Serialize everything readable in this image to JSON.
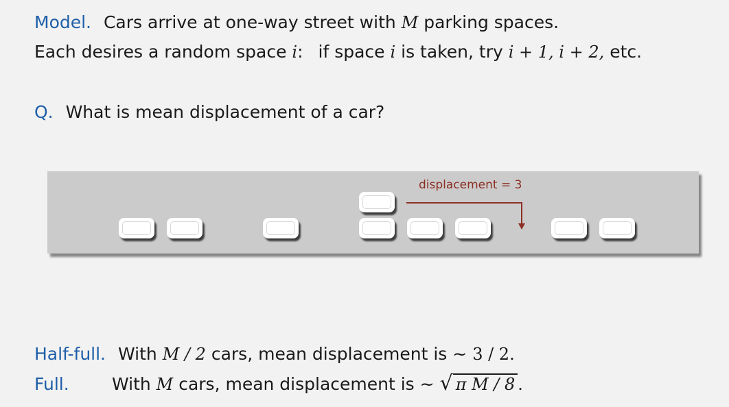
{
  "model": {
    "keyword": "Model.",
    "line1_a": "Cars arrive at one-way street with",
    "line1_var": "M",
    "line1_b": "parking spaces.",
    "line2_a": "Each desires a random space",
    "line2_var": "i",
    "line2_colon": ":",
    "line2_b": "if space",
    "line2_var2": "i",
    "line2_c": "is taken, try",
    "line2_math": "i + 1, i + 2,",
    "line2_d": "etc."
  },
  "question": {
    "keyword": "Q.",
    "text": "What is mean displacement of a car?"
  },
  "diagram": {
    "displacement_label": "displacement = 3",
    "colors": {
      "arrow": "#8c2f24",
      "street": "#cbcbcb",
      "car": "#ffffff"
    }
  },
  "half_full": {
    "keyword": "Half-full.",
    "text_a": "With",
    "math_a": "M / 2",
    "text_b": "cars, mean displacement is ~",
    "math_b": "3 / 2."
  },
  "full": {
    "keyword": "Full.",
    "text_a": "With",
    "math_a": "M",
    "text_b": "cars, mean displacement is ~",
    "sqrt_content": "π M / 8",
    "period": "."
  }
}
